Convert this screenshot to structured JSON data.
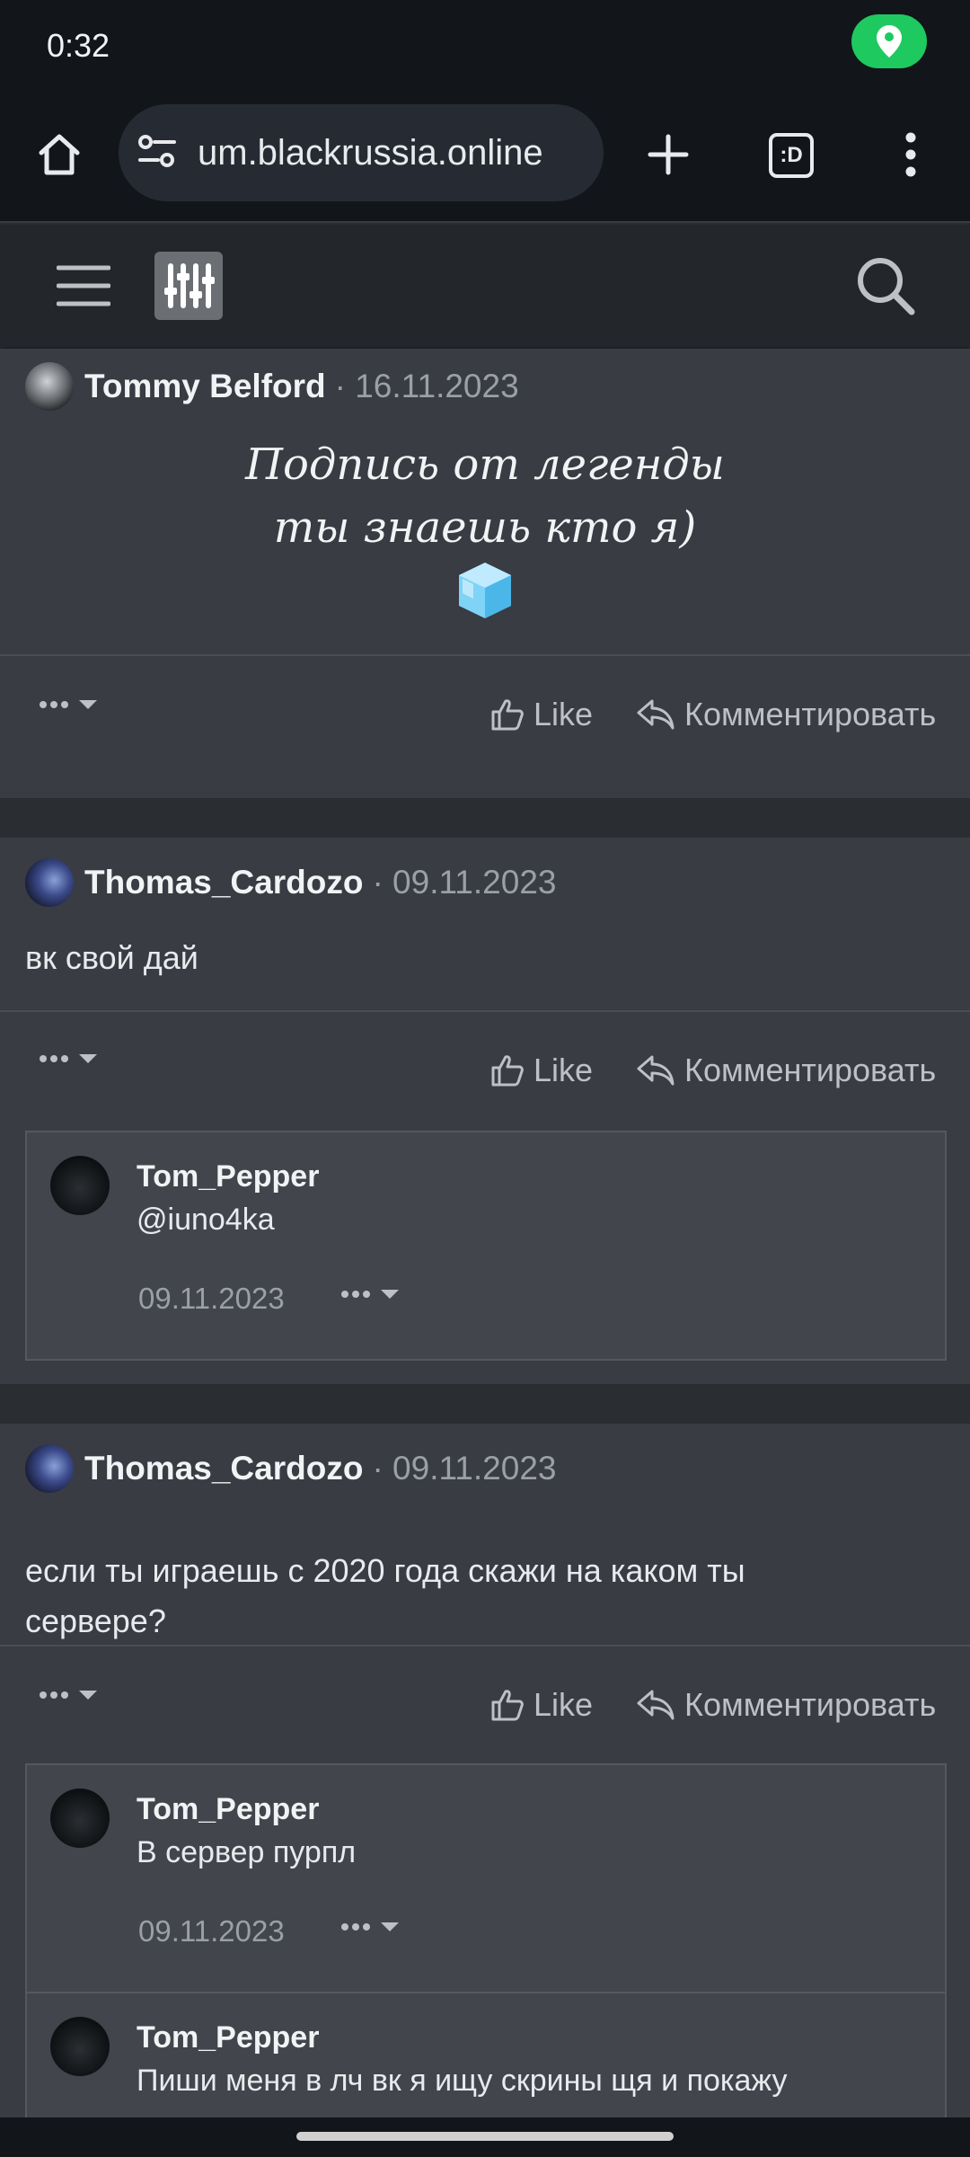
{
  "status_bar": {
    "time": "0:32",
    "location_icon": "location-pin-icon"
  },
  "browser": {
    "url": "um.blackrussia.online",
    "home_icon": "home-icon",
    "site_settings_icon": "tune-icon",
    "new_tab_icon": "plus-icon",
    "tabs_label": ":D",
    "menu_icon": "more-vert-icon"
  },
  "forum_header": {
    "menu_icon": "hamburger-icon",
    "logo_icon": "sliders-logo-icon",
    "search_icon": "search-icon"
  },
  "posts": [
    {
      "author": "Tommy Belford",
      "date": "· 16.11.2023",
      "signature": [
        "Подпись от легенды",
        "ты знаешь кто я)"
      ],
      "like_label": "Like",
      "comment_label": "Комментировать"
    },
    {
      "author": "Thomas_Cardozo",
      "date": "· 09.11.2023",
      "text": "вк свой дай",
      "like_label": "Like",
      "comment_label": "Комментировать",
      "comments": [
        {
          "author": "Tom_Pepper",
          "text": "@iuno4ka",
          "date": "09.11.2023"
        }
      ]
    },
    {
      "author": "Thomas_Cardozo",
      "date": "· 09.11.2023",
      "text": "если ты играешь с 2020 года скажи на каком ты сервере?",
      "like_label": "Like",
      "comment_label": "Комментировать",
      "comments": [
        {
          "author": "Tom_Pepper",
          "text": "В сервер пурпл",
          "date": "09.11.2023"
        },
        {
          "author": "Tom_Pepper",
          "text": "Пиши меня в лч вк я ищу скрины щя и покажу"
        }
      ]
    }
  ],
  "colors": {
    "accent_green": "#1ec95f",
    "post_bg": "#393c43",
    "comment_bg": "#42454c",
    "page_bg": "#2a2d32"
  }
}
